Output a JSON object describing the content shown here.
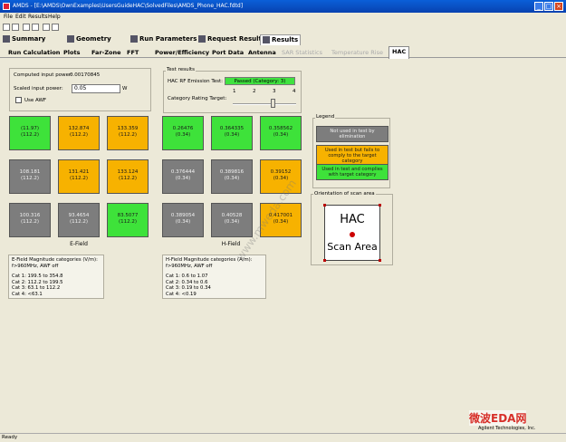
{
  "window": {
    "title": "AMDS - [E:\\AMDS\\OwnExamples\\UsersGuideHAC\\SolvedFiles\\AMDS_Phone_HAC.fdtd]"
  },
  "menu": [
    "File",
    "Edit",
    "Results",
    "Help"
  ],
  "main_tabs": [
    "Summary",
    "Geometry",
    "Run Parameters",
    "Request Results",
    "Results"
  ],
  "sub_tabs": [
    "Run Calculation",
    "Plots",
    "Far-Zone",
    "FFT",
    "Power/Efficiency",
    "Port Data",
    "Antenna",
    "SAR Statistics",
    "Temperature Rise",
    "HAC"
  ],
  "inputs": {
    "computed_label": "Computed input power:",
    "computed_value": "0.00170845",
    "scaled_label": "Scaled input power:",
    "scaled_value": "0.05",
    "scaled_unit": "W",
    "use_awf_label": "Use AWF"
  },
  "test_results": {
    "title": "Test results",
    "emission_label": "HAC RF Emission Test:",
    "emission_value": "Passed (Category: 3)",
    "target_label": "Category Rating Target:",
    "slider_ticks": [
      "1",
      "2",
      "3",
      "4"
    ],
    "target_value": 3
  },
  "efield": {
    "caption": "E-Field",
    "cells": [
      {
        "v": "(11.97)",
        "c": "(112.2)",
        "color": "green"
      },
      {
        "v": "132.874",
        "c": "(112.2)",
        "color": "orange"
      },
      {
        "v": "133.359",
        "c": "(112.2)",
        "color": "orange"
      },
      {
        "v": "108.181",
        "c": "(112.2)",
        "color": "gray"
      },
      {
        "v": "131.421",
        "c": "(112.2)",
        "color": "orange"
      },
      {
        "v": "133.124",
        "c": "(112.2)",
        "color": "orange"
      },
      {
        "v": "100.316",
        "c": "(112.2)",
        "color": "gray"
      },
      {
        "v": "93.4654",
        "c": "(112.2)",
        "color": "gray"
      },
      {
        "v": "83.5077",
        "c": "(112.2)",
        "color": "green"
      }
    ],
    "cat_title": "E-Field Magnitude categories (V/m):",
    "cat_sub": "f>960MHz, AWF off",
    "cats": [
      "Cat 1: 199.5 to 354.8",
      "Cat 2: 112.2 to 199.5",
      "Cat 3: 63.1 to 112.2",
      "Cat 4: <63.1"
    ]
  },
  "hfield": {
    "caption": "H-Field",
    "cells": [
      {
        "v": "0.26476",
        "c": "(0.34)",
        "color": "green"
      },
      {
        "v": "0.364335",
        "c": "(0.34)",
        "color": "green"
      },
      {
        "v": "0.358562",
        "c": "(0.34)",
        "color": "green"
      },
      {
        "v": "0.376444",
        "c": "(0.34)",
        "color": "gray"
      },
      {
        "v": "0.389816",
        "c": "(0.34)",
        "color": "gray"
      },
      {
        "v": "0.39152",
        "c": "(0.34)",
        "color": "orange"
      },
      {
        "v": "0.389054",
        "c": "(0.34)",
        "color": "gray"
      },
      {
        "v": "0.40528",
        "c": "(0.34)",
        "color": "gray"
      },
      {
        "v": "0.417001",
        "c": "(0.34)",
        "color": "orange"
      }
    ],
    "cat_title": "H-Field Magnitude categories (A/m):",
    "cat_sub": "f>960MHz, AWF off",
    "cats": [
      "Cat 1: 0.6 to 1.07",
      "Cat 2: 0.34 to 0.6",
      "Cat 3: 0.19 to 0.34",
      "Cat 4: <0.19"
    ]
  },
  "legend": {
    "title": "Legend",
    "items": [
      {
        "text": "Not used in test by elimination",
        "color": "gray"
      },
      {
        "text": "Used in test but fails to comply to the target category",
        "color": "orange"
      },
      {
        "text": "Used in test and complies with target category",
        "color": "green"
      }
    ]
  },
  "orientation": {
    "title": "Orientation of scan area",
    "line1": "HAC",
    "line2": "Scan Area"
  },
  "status": {
    "left": "Ready",
    "right": "Agilent Technologies, Inc."
  },
  "watermark": {
    "brand": "微波EDA网",
    "url": "www.mweda.com"
  },
  "colors": {
    "green": "#3ee23a",
    "orange": "#f7b200",
    "gray": "#7d7d7d"
  }
}
